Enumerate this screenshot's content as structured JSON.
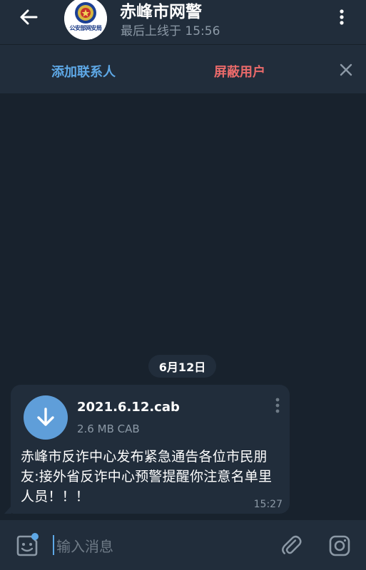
{
  "header": {
    "title": "赤峰市网警",
    "status": "最后上线于 15:56",
    "avatar_text": "公安部网安局"
  },
  "action_bar": {
    "add_contact": "添加联系人",
    "block_user": "屏蔽用户"
  },
  "chat": {
    "date": "6月12日",
    "message": {
      "file_name": "2021.6.12.cab",
      "file_meta": "2.6 MB CAB",
      "text": "赤峰市反诈中心发布紧急通告各位市民朋友:接外省反诈中心预警提醒你注意名单里人员！！！",
      "time": "15:27"
    }
  },
  "composer": {
    "placeholder": "输入消息"
  },
  "colors": {
    "background": "#18222d",
    "panel": "#212d3b",
    "accent": "#5ea8e6",
    "danger": "#e96a6a",
    "muted": "#8c99a6"
  },
  "icons": [
    "back-arrow-icon",
    "more-vert-icon",
    "close-icon",
    "download-icon",
    "emoji-sticker-icon",
    "paperclip-icon",
    "instagram-camera-icon"
  ]
}
